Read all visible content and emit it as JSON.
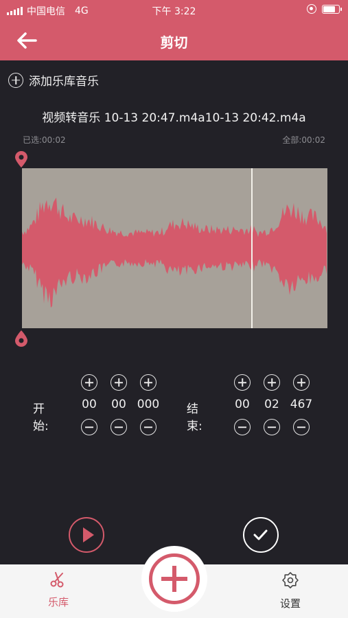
{
  "status_bar": {
    "carrier": "中国电信",
    "network": "4G",
    "time": "下午 3:22",
    "battery_level": 0.85
  },
  "nav": {
    "title": "剪切",
    "back_icon": "arrow-left-icon"
  },
  "add_music": {
    "label": "添加乐库音乐",
    "icon": "plus-circle-icon"
  },
  "file_name": "视频转音乐 10-13 20:47.m4a10-13 20:42.m4a",
  "selected_time": "已选:00:02",
  "total_time": "全部:00:02",
  "waveform": {
    "playhead_fraction": 0.75,
    "wave_color": "#d45a6b",
    "background_color": "#a7a199"
  },
  "start": {
    "label": "开始:",
    "minutes": "00",
    "seconds": "00",
    "millis": "000"
  },
  "end": {
    "label": "结束:",
    "minutes": "00",
    "seconds": "02",
    "millis": "467"
  },
  "tabs": {
    "library": {
      "label": "乐库",
      "icon": "scissors-icon"
    },
    "settings": {
      "label": "设置",
      "icon": "gear-icon"
    }
  },
  "colors": {
    "accent": "#d45a6b",
    "background": "#222127"
  }
}
